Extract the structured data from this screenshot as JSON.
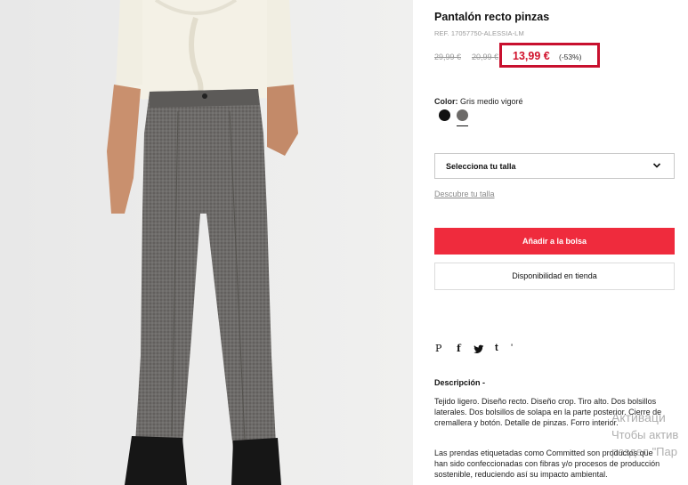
{
  "product": {
    "title": "Pantalón recto pinzas",
    "ref": "REF. 17057750-ALESSIA-LM",
    "old_price_1": "29,99 €",
    "old_price_2": "20,99 €",
    "price": "13,99 €",
    "discount": "(-53%)",
    "color_label": "Color:",
    "color_value": "Gris medio vigoré",
    "swatches": [
      "black",
      "grey"
    ],
    "accent_color": "#d0112b"
  },
  "size": {
    "placeholder": "Selecciona tu talla",
    "guide_link": "Descubre tu talla"
  },
  "actions": {
    "add_to_bag": "Añadir a la bolsa",
    "store_availability": "Disponibilidad en tienda"
  },
  "social": {
    "icons": [
      "pinterest-icon",
      "facebook-icon",
      "twitter-icon",
      "tumblr-icon",
      "more-icon"
    ],
    "p": "P",
    "f": "f",
    "t": "t",
    "more": "'"
  },
  "description": {
    "title": "Descripción -",
    "text": "Tejido ligero. Diseño recto. Diseño crop. Tiro alto. Dos bolsillos laterales. Dos bolsillos de solapa en la parte posterior. Cierre de cremallera y botón. Detalle de pinzas. Forro interior.",
    "text2": "Las prendas etiquetadas como Committed son productos que han sido confeccionadas con fibras y/o procesos de producción sostenible, reduciendo así su impacto ambiental."
  },
  "watermark": {
    "line1": "Активаци",
    "line2": "Чтобы актив",
    "line3": "раздел \"Пар"
  }
}
